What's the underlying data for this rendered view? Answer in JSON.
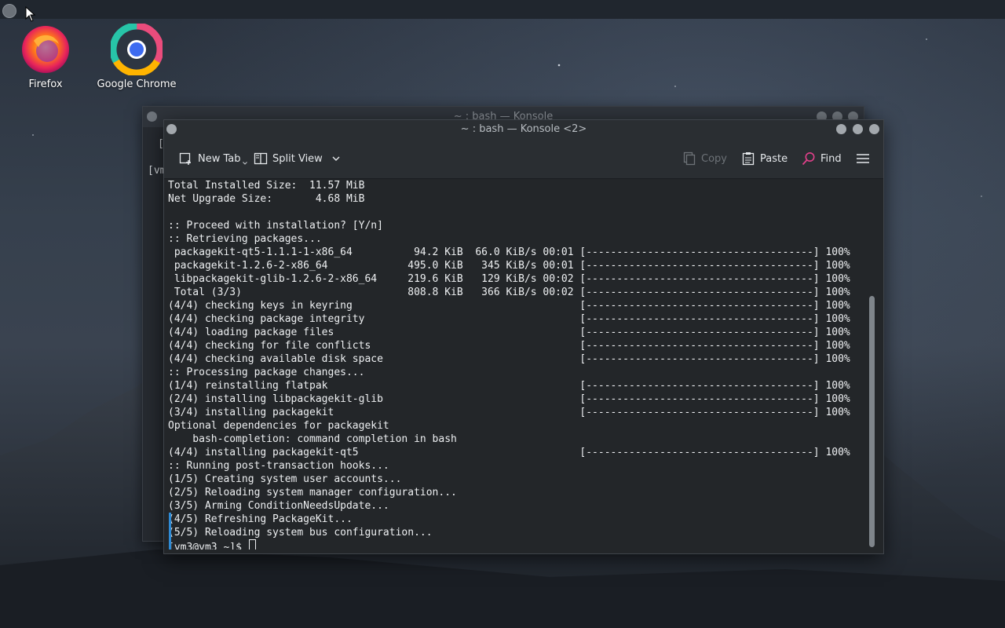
{
  "desktop": {
    "icons": [
      {
        "label": "Firefox"
      },
      {
        "label": "Google Chrome"
      }
    ]
  },
  "back_window": {
    "title": "~ : bash — Konsole",
    "fragment_1": "[",
    "fragment_2": "[vm"
  },
  "window": {
    "title": "~ : bash — Konsole <2>",
    "toolbar": {
      "new_tab": "New Tab",
      "split_view": "Split View",
      "copy": "Copy",
      "paste": "Paste",
      "find": "Find"
    }
  },
  "terminal": {
    "lines": [
      "Total Installed Size:  11.57 MiB",
      "Net Upgrade Size:       4.68 MiB",
      "",
      ":: Proceed with installation? [Y/n]",
      ":: Retrieving packages...",
      " packagekit-qt5-1.1.1-1-x86_64          94.2 KiB  66.0 KiB/s 00:01 [-------------------------------------] 100%",
      " packagekit-1.2.6-2-x86_64             495.0 KiB   345 KiB/s 00:01 [-------------------------------------] 100%",
      " libpackagekit-glib-1.2.6-2-x86_64     219.6 KiB   129 KiB/s 00:02 [-------------------------------------] 100%",
      " Total (3/3)                           808.8 KiB   366 KiB/s 00:02 [-------------------------------------] 100%",
      "(4/4) checking keys in keyring                                     [-------------------------------------] 100%",
      "(4/4) checking package integrity                                   [-------------------------------------] 100%",
      "(4/4) loading package files                                        [-------------------------------------] 100%",
      "(4/4) checking for file conflicts                                  [-------------------------------------] 100%",
      "(4/4) checking available disk space                                [-------------------------------------] 100%",
      ":: Processing package changes...",
      "(1/4) reinstalling flatpak                                         [-------------------------------------] 100%",
      "(2/4) installing libpackagekit-glib                                [-------------------------------------] 100%",
      "(3/4) installing packagekit                                        [-------------------------------------] 100%",
      "Optional dependencies for packagekit",
      "    bash-completion: command completion in bash",
      "(4/4) installing packagekit-qt5                                    [-------------------------------------] 100%",
      ":: Running post-transaction hooks...",
      "(1/5) Creating system user accounts...",
      "(2/5) Reloading system manager configuration...",
      "(3/5) Arming ConditionNeedsUpdate...",
      "(4/5) Refreshing PackageKit...",
      "(5/5) Reloading system bus configuration..."
    ],
    "prompt": "[vm3@vm3 ~]$ "
  },
  "colors": {
    "terminal_bg": "#232629",
    "terminal_fg": "#eef0f2",
    "find_icon": "#e0408a",
    "marker": "#2e8bd6"
  }
}
